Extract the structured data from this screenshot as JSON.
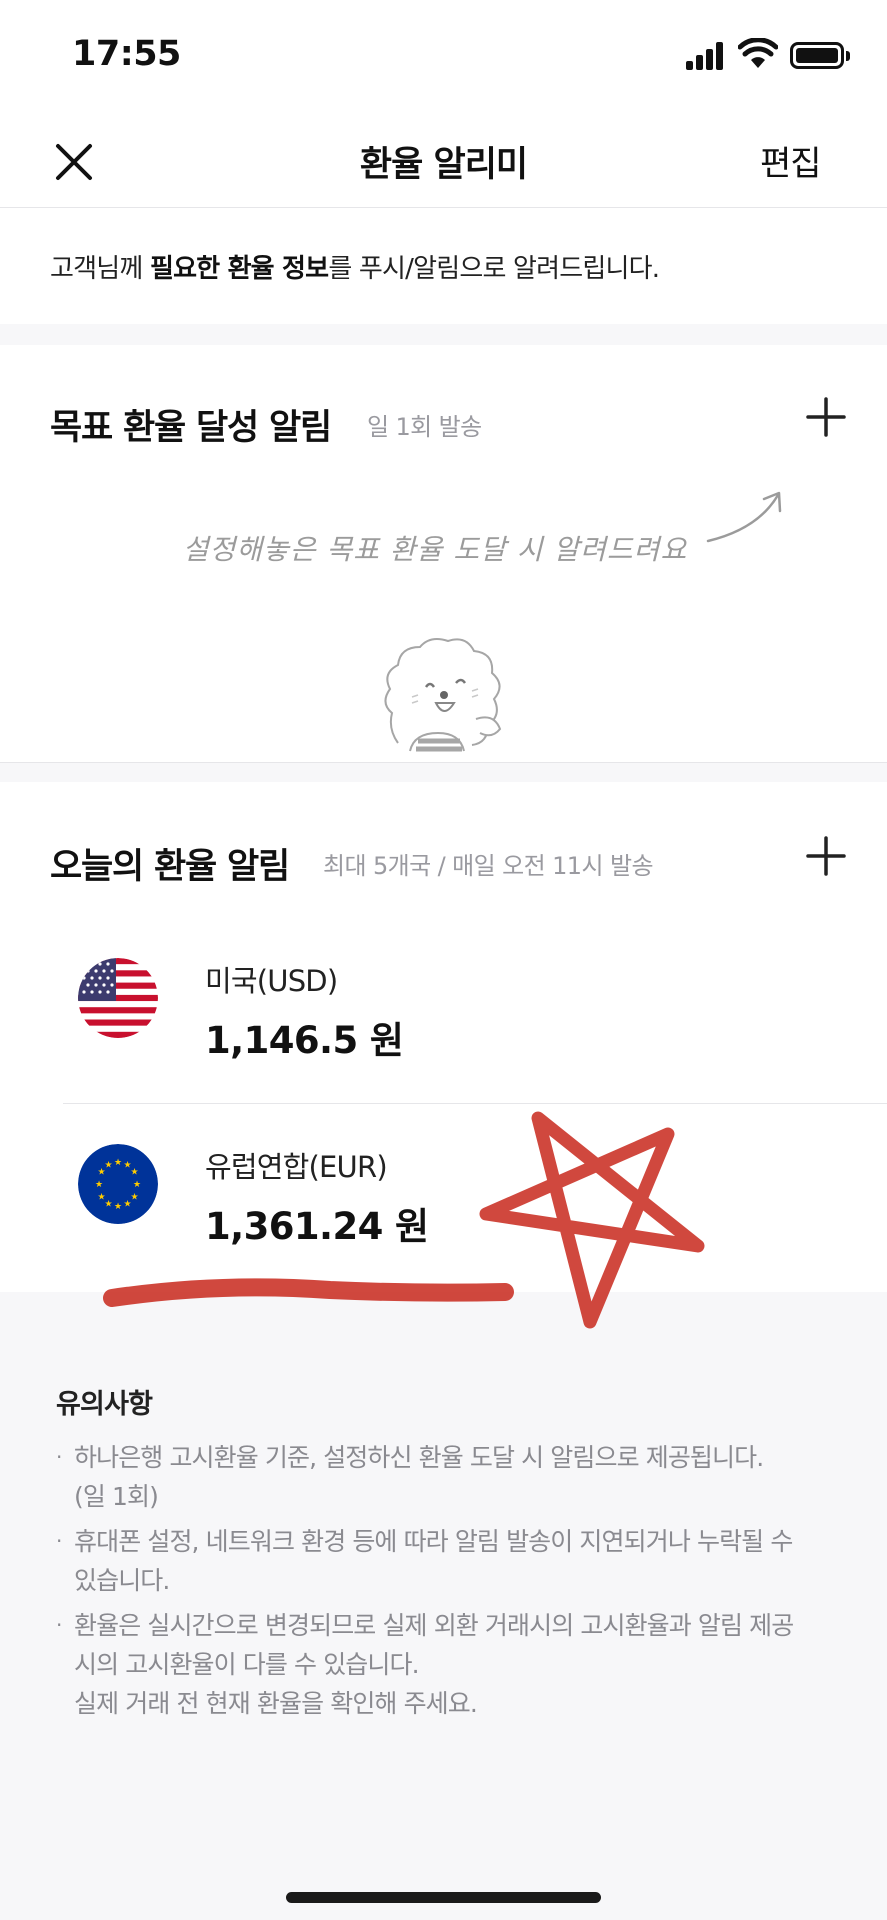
{
  "status_bar": {
    "time": "17:55"
  },
  "header": {
    "title": "환율 알리미",
    "edit_label": "편집"
  },
  "intro": {
    "prefix": "고객님께 ",
    "bold": "필요한 환율 정보",
    "suffix": "를 푸시/알림으로 알려드립니다."
  },
  "target_alert": {
    "title": "목표 환율 달성 알림",
    "subtitle": "일 1회 발송",
    "empty_message": "설정해놓은 목표 환율 도달 시 알려드려요"
  },
  "today_alert": {
    "title": "오늘의 환율 알림",
    "subtitle": "최대 5개국 / 매일 오전 11시 발송",
    "currencies": [
      {
        "name": "미국(USD)",
        "rate": "1,146.5 원",
        "flag": "us-flag"
      },
      {
        "name": "유럽연합(EUR)",
        "rate": "1,361.24 원",
        "flag": "eu-flag"
      }
    ]
  },
  "notes": {
    "title": "유의사항",
    "items": [
      {
        "line1": "하나은행 고시환율 기준, 설정하신 환율 도달 시 알림으로 제공됩니다.",
        "line2": "(일 1회)"
      },
      {
        "line1": "휴대폰 설정, 네트워크 환경 등에 따라 알림 발송이 지연되거나 누락될 수",
        "line2": "있습니다."
      },
      {
        "line1": "환율은 실시간으로 변경되므로 실제 외환 거래시의 고시환율과 알림 제공",
        "line2": "시의 고시환율이 다를 수 있습니다.",
        "line3": "실제 거래 전 현재 환율을 확인해 주세요."
      }
    ]
  },
  "colors": {
    "annotation_red": "#c8281c",
    "muted_text": "#9a9aa0",
    "divider": "#e6e6e9"
  }
}
